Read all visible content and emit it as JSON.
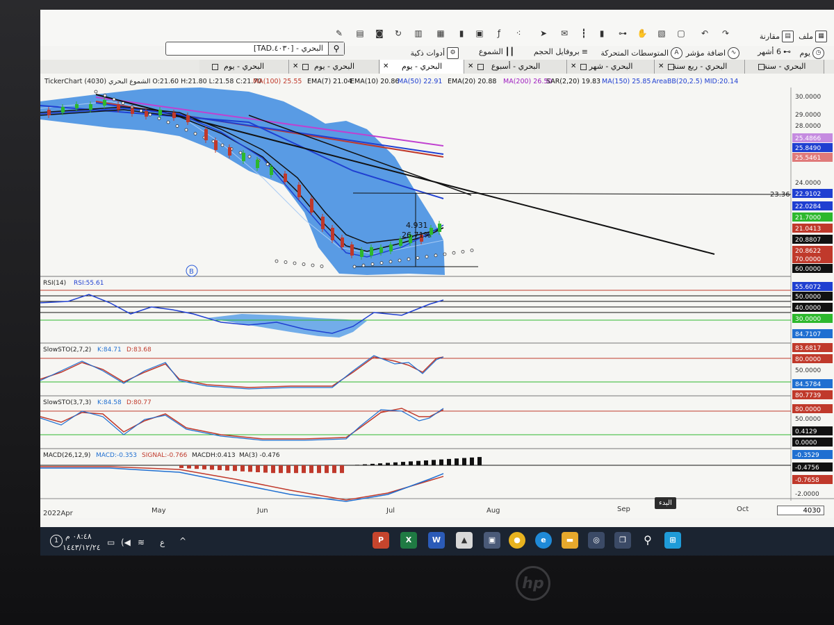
{
  "toolbar": {
    "file": "ملف",
    "compare": "مقارنة",
    "smart_tools": "أدوات ذكية",
    "candles": "الشموع",
    "volume_profile": "بروفايل الحجم",
    "moving_averages": "المتوسطات المتحركة",
    "add_indicator": "اضافة مؤشر",
    "six_months": "6 أشهر",
    "day": "يوم"
  },
  "search": {
    "value": "[TAD.٤٠٣٠] - البحري"
  },
  "tabs": [
    {
      "label": "البحري - سنة"
    },
    {
      "label": "البحري - ربع سنة"
    },
    {
      "label": "البحري - شهر"
    },
    {
      "label": "البحري - أسبوع"
    },
    {
      "label": "البحري - يوم"
    },
    {
      "label": "البحري - يوم"
    },
    {
      "label": "البحري - يوم"
    }
  ],
  "legend_main": {
    "prefix": "TickerChart الشموع البحري (4030) O:21.60 H:21.80 L:21.58 C:21.70",
    "items": [
      {
        "text": "MA(100) 25.55",
        "color": "#c0392b"
      },
      {
        "text": "EMA(7) 21.04",
        "color": "#111111"
      },
      {
        "text": "EMA(10) 20.86",
        "color": "#111111"
      },
      {
        "text": "MA(50) 22.91",
        "color": "#1f3fd1"
      },
      {
        "text": "EMA(20) 20.88",
        "color": "#111111"
      },
      {
        "text": "MA(200) 26.50",
        "color": "#a020c0"
      },
      {
        "text": "SAR(2,20) 19.83",
        "color": "#111111"
      },
      {
        "text": "MA(150) 25.85",
        "color": "#1f3fd1"
      },
      {
        "text": "AreaBB(20,2.5) MID:20.14",
        "color": "#1f3fd1"
      }
    ]
  },
  "price_axis": [
    "30.0000",
    "29.0000",
    "28.0000",
    "24.0000"
  ],
  "price_labels": [
    {
      "text": "25.4866",
      "color": "#c58be0"
    },
    {
      "text": "25.8490",
      "color": "#1f3fd1"
    },
    {
      "text": "25.5461",
      "color": "#e07a7a"
    },
    {
      "text": "22.9102",
      "color": "#1f3fd1"
    },
    {
      "text": "22.0284",
      "color": "#1f3fd1"
    },
    {
      "text": "21.7000",
      "color": "#2db82d"
    },
    {
      "text": "21.0413",
      "color": "#c0392b"
    },
    {
      "text": "20.8807",
      "color": "#111111"
    },
    {
      "text": "20.8622",
      "color": "#c0392b"
    },
    {
      "text": "70.0000",
      "color": "#c0392b"
    },
    {
      "text": "60.0000",
      "color": "#111111"
    }
  ],
  "trend_value": "23.36",
  "measure": {
    "value": "4.931",
    "percent": "26.71%"
  },
  "marker_b": "B",
  "rsi": {
    "title": "RSI(14)",
    "value": "RSI:55.61",
    "axis": [
      {
        "text": "55.6072",
        "color": "#1f3fd1"
      },
      {
        "text": "50.0000",
        "color": "#111111"
      },
      {
        "text": "40.0000",
        "color": "#111111"
      },
      {
        "text": "30.0000",
        "color": "#2db82d"
      },
      {
        "text": "84.7107",
        "color": "#1f6fd1"
      }
    ]
  },
  "sto1": {
    "title": "SlowSTO(2,7,2)",
    "k": "K:84.71",
    "d": "D:83.68",
    "axis": [
      {
        "text": "83.6817",
        "color": "#c0392b"
      },
      {
        "text": "80.0000",
        "color": "#c0392b"
      },
      {
        "text": "50.0000",
        "color": null
      },
      {
        "text": "84.5784",
        "color": "#1f6fd1"
      },
      {
        "text": "80.7739",
        "color": "#c0392b"
      }
    ]
  },
  "sto2": {
    "title": "SlowSTO(3,7,3)",
    "k": "K:84.58",
    "d": "D:80.77",
    "axis": [
      {
        "text": "80.0000",
        "color": "#c0392b"
      },
      {
        "text": "50.0000",
        "color": null
      },
      {
        "text": "0.4129",
        "color": "#111111"
      },
      {
        "text": "0.0000",
        "color": "#111111"
      }
    ]
  },
  "macd": {
    "title": "MACD(26,12,9)",
    "macd": "MACD:-0.353",
    "signal": "SIGNAL:-0.766",
    "hist": "MACDH:0.413",
    "ma": "MA(3) -0.476",
    "axis": [
      {
        "text": "-0.3529",
        "color": "#1f6fd1"
      },
      {
        "text": "-0.4756",
        "color": "#111111"
      },
      {
        "text": "-0.7658",
        "color": "#c0392b"
      },
      {
        "text": "-2.0000",
        "color": null
      }
    ]
  },
  "time_axis": [
    "2022Apr",
    "May",
    "Jun",
    "Jul",
    "Aug",
    "Sep",
    "Oct"
  ],
  "zoom_value": "4030",
  "tooltip": "البدء",
  "clock": {
    "time": "٠٨:٤٨ م",
    "date": "١٤٤٣/١٢/٢٤",
    "lang": "ع",
    "badge": "1"
  },
  "colors": {
    "accent": "#1f3fd1",
    "bb_fill": "#3d8be0",
    "up": "#2db82d",
    "down": "#c0392b"
  }
}
